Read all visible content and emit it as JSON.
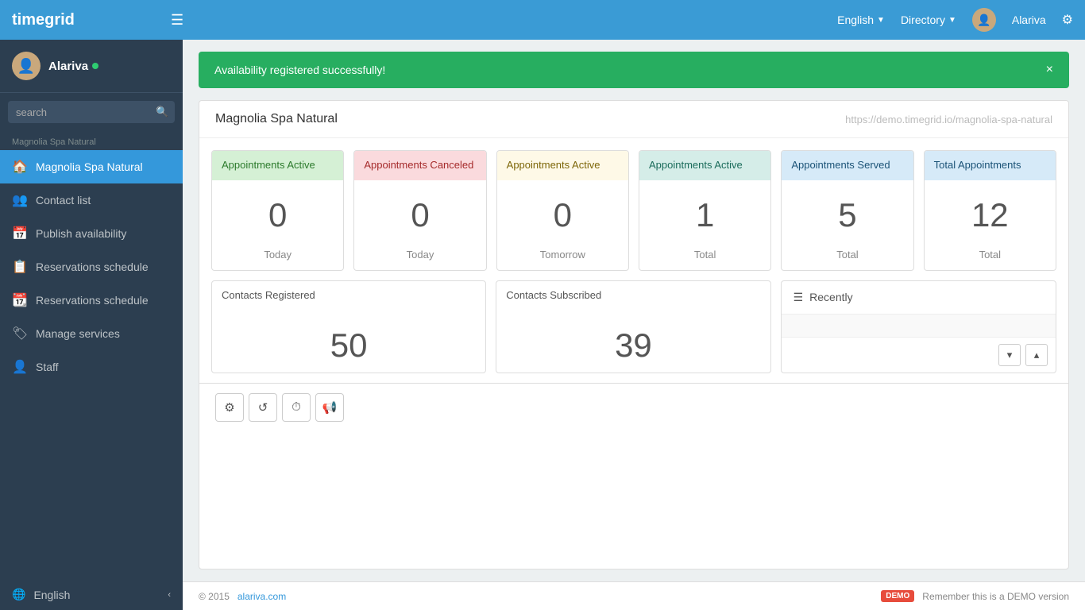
{
  "app": {
    "brand": "timegrid"
  },
  "topnav": {
    "hamburger": "☰",
    "language": "English",
    "directory": "Directory",
    "username": "Alariva",
    "gear_icon": "⚙"
  },
  "sidebar": {
    "username": "Alariva",
    "online": true,
    "search_placeholder": "search",
    "section_label": "Magnolia Spa Natural",
    "items": [
      {
        "id": "home",
        "label": "Magnolia Spa Natural",
        "icon": "🏠",
        "active": true
      },
      {
        "id": "contacts",
        "label": "Contact list",
        "icon": "👥",
        "active": false
      },
      {
        "id": "publish",
        "label": "Publish availability",
        "icon": "📅",
        "active": false
      },
      {
        "id": "reservations1",
        "label": "Reservations schedule",
        "icon": "📋",
        "active": false
      },
      {
        "id": "reservations2",
        "label": "Reservations schedule",
        "icon": "📆",
        "active": false
      },
      {
        "id": "services",
        "label": "Manage services",
        "icon": "🏷",
        "active": false
      },
      {
        "id": "staff",
        "label": "Staff",
        "icon": "👤",
        "active": false
      }
    ],
    "language": "English"
  },
  "alert": {
    "message": "Availability registered successfully!",
    "close": "×"
  },
  "card": {
    "title": "Magnolia Spa Natural",
    "url": "https://demo.timegrid.io/magnolia-spa-natural"
  },
  "stats": [
    {
      "header": "Appointments Active",
      "color": "green",
      "value": "0",
      "footer": "Today"
    },
    {
      "header": "Appointments Canceled",
      "color": "red",
      "value": "0",
      "footer": "Today"
    },
    {
      "header": "Appointments Active",
      "color": "yellow",
      "value": "0",
      "footer": "Tomorrow"
    },
    {
      "header": "Appointments Active",
      "color": "blue-green",
      "value": "1",
      "footer": "Total"
    },
    {
      "header": "Appointments Served",
      "color": "light-blue",
      "value": "5",
      "footer": "Total"
    },
    {
      "header": "Total Appointments",
      "color": "ice-blue",
      "value": "12",
      "footer": "Total"
    }
  ],
  "contacts": [
    {
      "header": "Contacts Registered",
      "value": "50"
    },
    {
      "header": "Contacts Subscribed",
      "value": "39"
    }
  ],
  "recently": {
    "title": "Recently",
    "icon": "☰"
  },
  "toolbar": {
    "buttons": [
      "⚙",
      "↺",
      "⏱",
      "📢"
    ]
  },
  "footer": {
    "copyright": "© 2015",
    "link_text": "alariva.com",
    "demo_badge": "DEMO",
    "demo_text": "Remember this is a DEMO version"
  }
}
